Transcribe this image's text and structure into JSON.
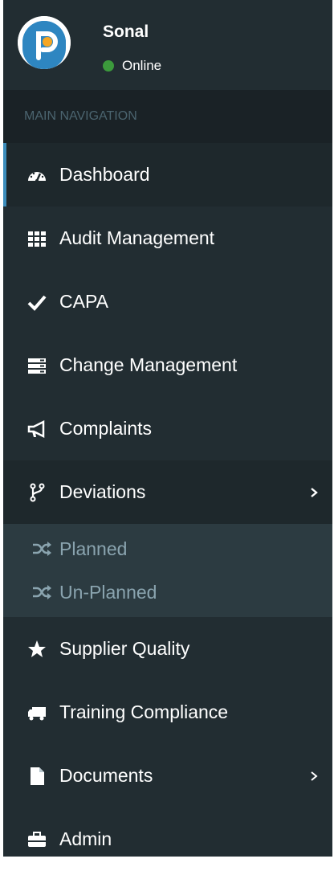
{
  "user": {
    "name": "Sonal",
    "status": "Online"
  },
  "nav_header": "MAIN NAVIGATION",
  "menu": {
    "dashboard": "Dashboard",
    "audit": "Audit Management",
    "capa": "CAPA",
    "change": "Change Management",
    "complaints": "Complaints",
    "deviations": "Deviations",
    "deviations_sub": {
      "planned": "Planned",
      "unplanned": "Un-Planned"
    },
    "supplier": "Supplier Quality",
    "training": "Training Compliance",
    "documents": "Documents",
    "admin": "Admin"
  },
  "colors": {
    "sidebar_bg": "#222d32",
    "header_bg": "#1a2226",
    "active_accent": "#3c8dbc",
    "submenu_bg": "#2c3b41",
    "online": "#3c9a3c"
  },
  "icons": {
    "dashboard": "tachometer-icon",
    "audit": "grid-icon",
    "capa": "check-icon",
    "change": "server-icon",
    "complaints": "bullhorn-icon",
    "deviations": "code-fork-icon",
    "planned": "random-icon",
    "unplanned": "random-icon",
    "supplier": "star-icon",
    "training": "truck-icon",
    "documents": "file-icon",
    "admin": "briefcase-icon"
  }
}
